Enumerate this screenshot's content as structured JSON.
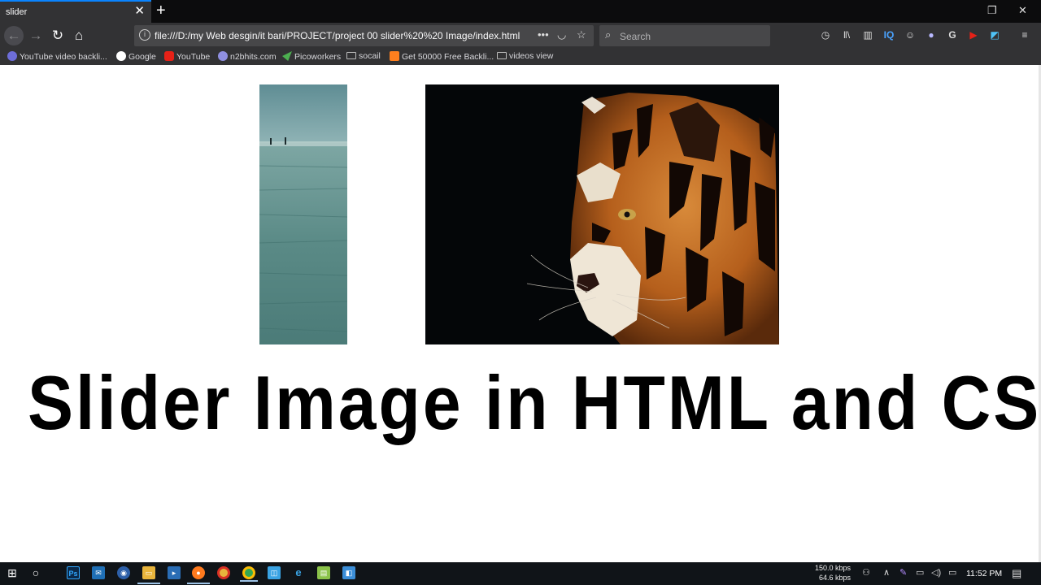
{
  "browser": {
    "tab_title": "slider",
    "tab_close": "✕",
    "new_tab": "+",
    "url": "file:///D:/my Web desgin/it bari/PROJECT/project 00 slider%20%20 Image/index.html",
    "search_placeholder": "Search",
    "bookmarks": [
      {
        "label": "YouTube video backli...",
        "icon": "youtube-tool-icon",
        "color": "#6d6dd8"
      },
      {
        "label": "Google",
        "icon": "google-icon",
        "color": "#ffffff"
      },
      {
        "label": "YouTube",
        "icon": "youtube-icon",
        "color": "#e62117"
      },
      {
        "label": "n2bhits.com",
        "icon": "site-icon",
        "color": "#8f8fe0"
      },
      {
        "label": "Picoworkers",
        "icon": "picoworkers-icon",
        "color": "#4caf50"
      },
      {
        "label": "socail",
        "icon": "folder-icon",
        "color": "#bbbbbb"
      },
      {
        "label": "Get 50000 Free Backli...",
        "icon": "blogger-icon",
        "color": "#ff7f1e"
      },
      {
        "label": "videos view",
        "icon": "folder-icon",
        "color": "#bbbbbb"
      }
    ]
  },
  "page": {
    "headline": "Slider Image in HTML and CSS",
    "images": [
      {
        "name": "sea-slide",
        "description_icon": "sea-image"
      },
      {
        "name": "tiger-slide",
        "description_icon": "tiger-image"
      }
    ]
  },
  "taskbar": {
    "network_up": "150.0 kbps",
    "network_down": "64.6 kbps",
    "time": "11:52 PM",
    "apps": [
      "start-icon",
      "cortana-icon",
      "photoshop-icon",
      "mail-icon",
      "network-app-icon",
      "file-explorer-icon",
      "terminal-icon",
      "firefox-icon",
      "chrome-icon",
      "chrome-alt-icon",
      "app-icon",
      "edge-icon",
      "notepad-icon",
      "store-icon"
    ]
  }
}
